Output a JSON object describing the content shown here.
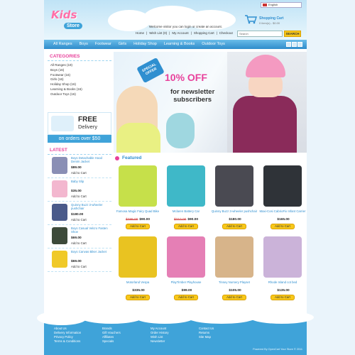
{
  "header": {
    "logo_kids": "Kids",
    "logo_store": "Store",
    "language": "English",
    "cart_title": "Shopping Cart",
    "cart_summary": "0 item(s) - $0.00",
    "welcome": "Welcome visitor you can login or create an account.",
    "top_links": [
      "Home",
      "Wish List (0)",
      "My Account",
      "Shopping Cart",
      "Checkout"
    ],
    "search_placeholder": "Search",
    "search_button": "SEARCH"
  },
  "nav": {
    "items": [
      "All Ranges",
      "Boys",
      "Footwear",
      "Girls",
      "Holiday Shop",
      "Learning & Books",
      "Outdoor Toys"
    ]
  },
  "categories": {
    "title": "CATEGORIES",
    "items": [
      "All Ranges (19)",
      "Boys (16)",
      "Footwear (16)",
      "Girls (16)",
      "Holiday Shop (16)",
      "Learning & Books (16)",
      "Outdoor Toys (16)"
    ]
  },
  "delivery": {
    "free": "FREE",
    "delivery": "Delivery",
    "orders": "on orders over $50"
  },
  "latest": {
    "title": "LATEST",
    "items": [
      {
        "name": "Boys Detachable Hood Denim Jacket",
        "price": "$89.00",
        "button": "Add to Cart"
      },
      {
        "name": "Baby Slip",
        "price": "$35.00",
        "button": "Add to Cart"
      },
      {
        "name": "Quinny Buzz 3-wheeler pushchair",
        "price": "$180.00",
        "button": "Add to Cart"
      },
      {
        "name": "Boys Casual Velcro Fasten Shoe",
        "price": "$69.00",
        "button": "Add to Cart"
      },
      {
        "name": "Boys Canvas Biker Jacket",
        "price": "$69.00",
        "button": "Add to Cart"
      }
    ]
  },
  "banner": {
    "badge": "SPECIAL OFFER",
    "headline": "10% OFF",
    "subline1": "for newsletter",
    "subline2": "subscribers"
  },
  "featured": {
    "title": "Featured",
    "products": [
      {
        "name": "Famosa Magic Fairy Quad Bike",
        "old_price": "$299.00",
        "price": "$90.00",
        "button": "Add to Cart",
        "color": "#c6e04a"
      },
      {
        "name": "Mclaren Battery Car",
        "old_price": "$310.00",
        "price": "$90.00",
        "button": "Add to Cart",
        "color": "#3fb8c8"
      },
      {
        "name": "Quinny Buzz 3-wheeler pushchair",
        "old_price": "",
        "price": "$180.00",
        "button": "Add to Cart",
        "color": "#4a4a52"
      },
      {
        "name": "Maxi-Cosi CabrioFix Infant Carrier",
        "old_price": "",
        "price": "$165.00",
        "button": "Add to Cart",
        "color": "#2f3338"
      },
      {
        "name": "Motorland Vespa",
        "old_price": "",
        "price": "$335.00",
        "button": "Add to Cart",
        "color": "#e9c321"
      },
      {
        "name": "PlayTimber Playhouse",
        "old_price": "",
        "price": "$99.00",
        "button": "Add to Cart",
        "color": "#e57fb5"
      },
      {
        "name": "Tinsey Nursery Playset",
        "old_price": "",
        "price": "$105.00",
        "button": "Add to Cart",
        "color": "#d7b48a"
      },
      {
        "name": "Rhode Island cot bed",
        "old_price": "",
        "price": "$135.00",
        "button": "Add to Cart",
        "color": "#cbb3d9"
      }
    ]
  },
  "footer": {
    "columns": [
      [
        "About Us",
        "Delivery Information",
        "Privacy Policy",
        "Terms & Conditions"
      ],
      [
        "Brands",
        "Gift Vouchers",
        "Affiliates",
        "Specials"
      ],
      [
        "My Account",
        "Order History",
        "Wish List",
        "Newsletter"
      ],
      [
        "Contact Us",
        "Returns",
        "Site Map"
      ]
    ],
    "powered": "Powered By OpenCart Your Store © 2011"
  },
  "colors": {
    "accent": "#3fa3d9",
    "pink": "#e8419b",
    "button": "#f8c81a"
  }
}
